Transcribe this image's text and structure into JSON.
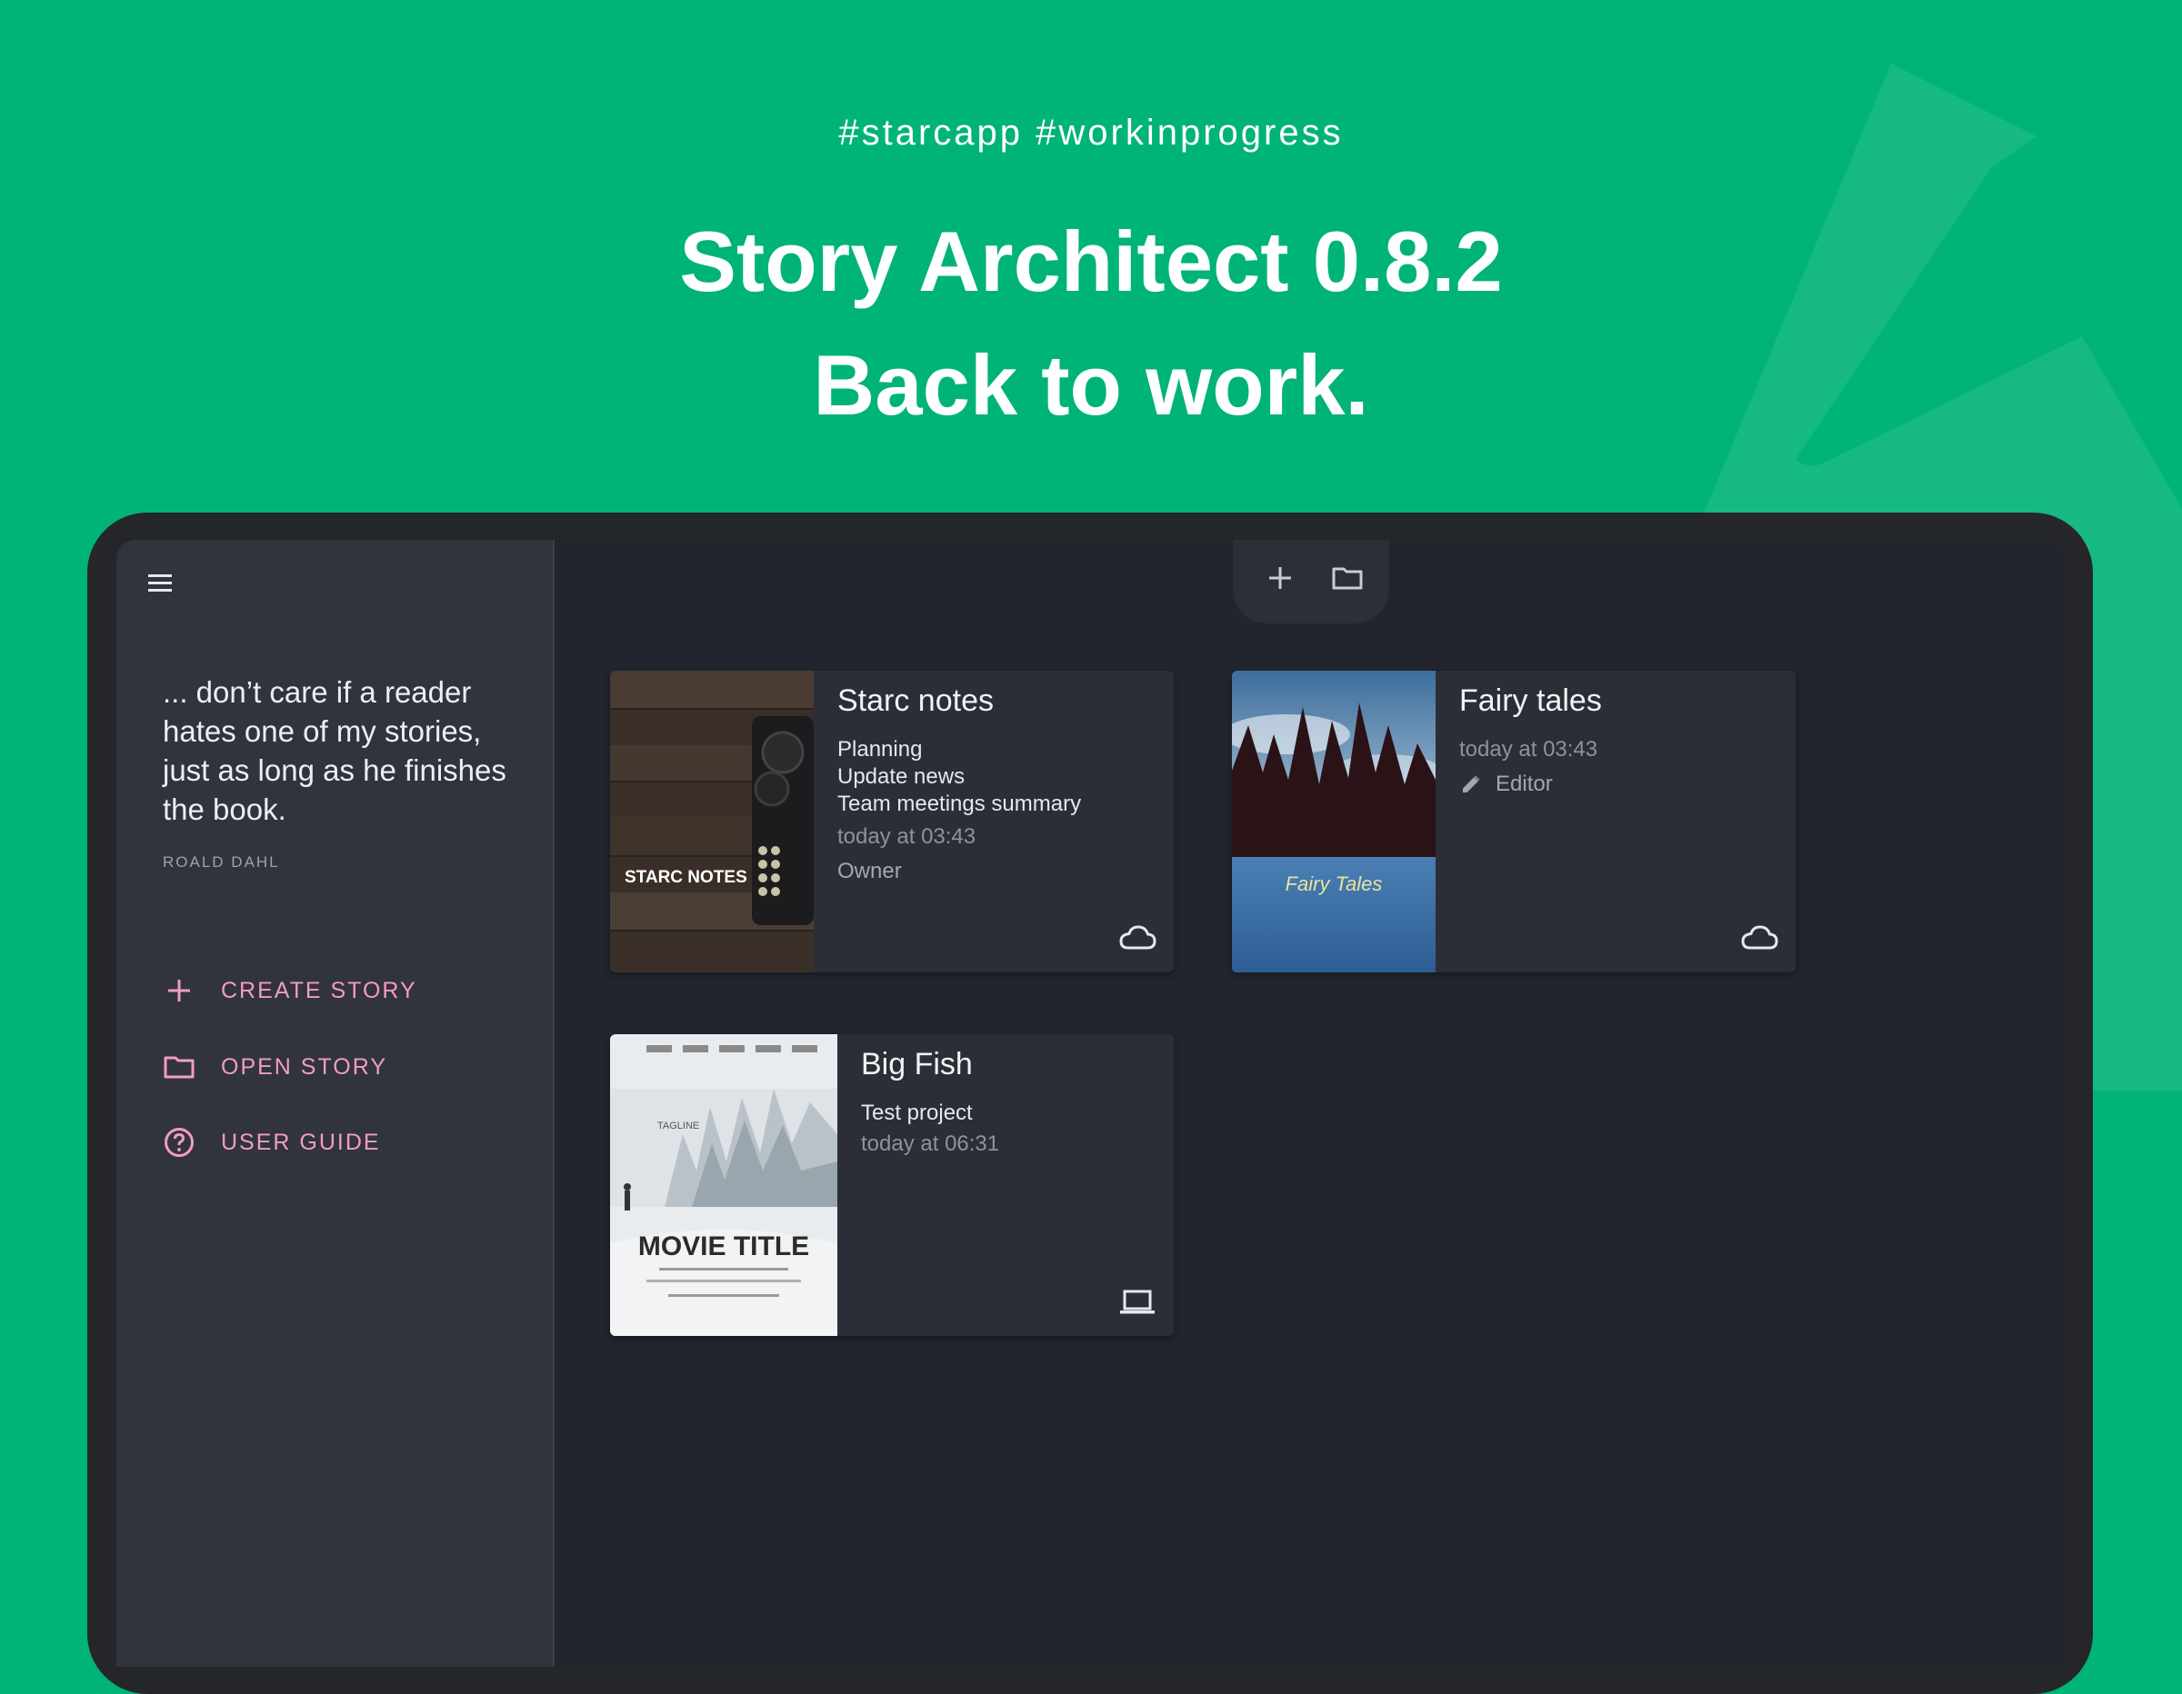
{
  "header": {
    "tags": "#starcapp  #workinprogress",
    "title_line1": "Story Architect 0.8.2",
    "title_line2": "Back to work."
  },
  "colors": {
    "background": "#00b377",
    "accent": "#f29bc8",
    "sidebar": "#31343d",
    "content": "#22252d",
    "card": "#2b2e36"
  },
  "sidebar": {
    "menu_icon": "hamburger-menu-icon",
    "quote": "... don’t care if a reader hates one of my stories, just as long as he finishes the book.",
    "author": "ROALD DAHL",
    "actions": [
      {
        "label": "CREATE STORY",
        "icon": "plus-icon"
      },
      {
        "label": "OPEN STORY",
        "icon": "folder-icon"
      },
      {
        "label": "USER GUIDE",
        "icon": "help-circle-icon"
      }
    ]
  },
  "toolbar": {
    "add_icon": "plus-icon",
    "open_icon": "folder-icon"
  },
  "projects": [
    {
      "title": "Starc notes",
      "cover_text": "STARC NOTES",
      "lines": [
        "Planning",
        "Update news",
        "Team meetings summary"
      ],
      "date": "today at 03:43",
      "role": "Owner",
      "status_icon": "cloud-icon"
    },
    {
      "title": "Fairy tales",
      "cover_text": "Fairy Tales",
      "lines": [],
      "date": "today at 03:43",
      "role": "Editor",
      "role_icon": "pencil-icon",
      "status_icon": "cloud-icon"
    },
    {
      "title": "Big Fish",
      "cover_text": "MOVIE TITLE",
      "cover_tagline": "TAGLINE",
      "lines": [
        "Test project"
      ],
      "date": "today at 06:31",
      "status_icon": "laptop-icon"
    }
  ]
}
